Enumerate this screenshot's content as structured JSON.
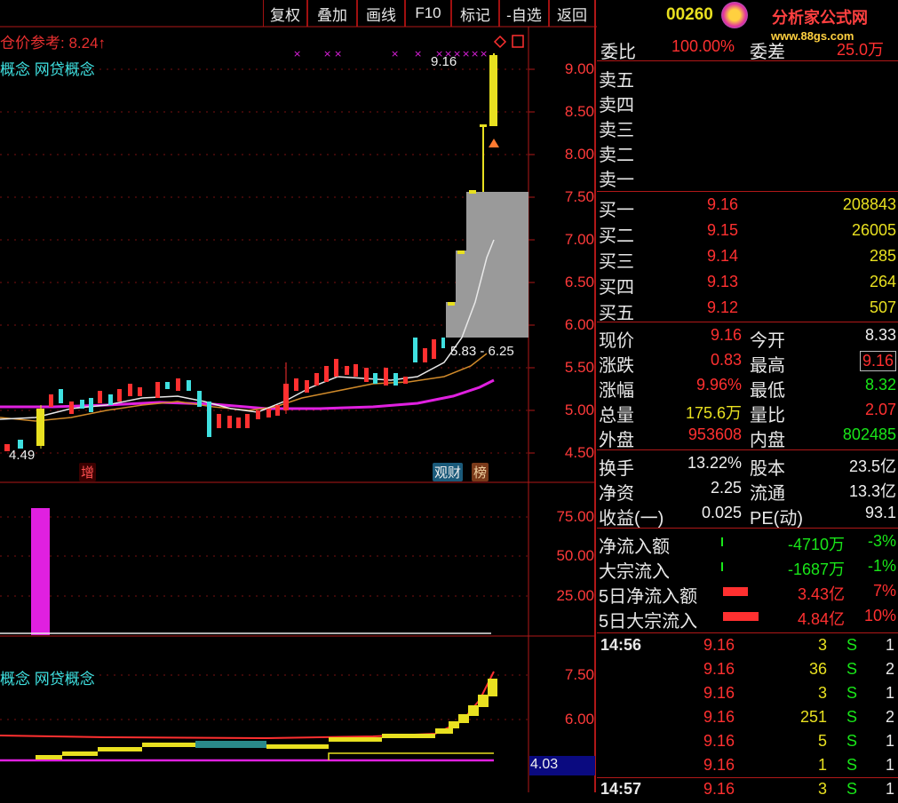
{
  "toolbar": {
    "buttons": [
      "复权",
      "叠加",
      "画线",
      "F10",
      "标记",
      "-自选",
      "返回"
    ]
  },
  "stock": {
    "code": "00260",
    "watermark_brand": "分析家公式网",
    "watermark_url": "www.88gs.com"
  },
  "main_chart": {
    "ref_price_label": "仓价参考: 8.24",
    "concept_label": "概念 网贷概念",
    "high_marker": "9.16",
    "range_marker": "5.83 - 6.25",
    "low_marker": "4.49",
    "tag_zeng": "增",
    "tag_guan": "观财",
    "tag_bang": "榜",
    "y_axis": [
      "9.00",
      "8.50",
      "8.00",
      "7.50",
      "7.00",
      "6.50",
      "6.00",
      "5.50",
      "5.00",
      "4.50"
    ]
  },
  "vol_chart": {
    "y_axis": [
      "75.00",
      "50.00",
      "25.00"
    ]
  },
  "ind_chart": {
    "concept_label": "概念 网贷概念",
    "y_axis": [
      "7.50",
      "6.00"
    ],
    "current_value": "4.03"
  },
  "order_book": {
    "weibi_label": "委比",
    "weibi_value": "100.00%",
    "weicha_label": "委差",
    "weicha_value": "25.0万",
    "sells": [
      "卖五",
      "卖四",
      "卖三",
      "卖二",
      "卖一"
    ],
    "buys": [
      {
        "label": "买一",
        "price": "9.16",
        "vol": "208843"
      },
      {
        "label": "买二",
        "price": "9.15",
        "vol": "26005"
      },
      {
        "label": "买三",
        "price": "9.14",
        "vol": "285"
      },
      {
        "label": "买四",
        "price": "9.13",
        "vol": "264"
      },
      {
        "label": "买五",
        "price": "9.12",
        "vol": "507"
      }
    ]
  },
  "quote": {
    "rows": [
      {
        "l1": "现价",
        "v1": "9.16",
        "l2": "今开",
        "v2": "8.33"
      },
      {
        "l1": "涨跌",
        "v1": "0.83",
        "l2": "最高",
        "v2": "9.16"
      },
      {
        "l1": "涨幅",
        "v1": "9.96%",
        "l2": "最低",
        "v2": "8.32"
      },
      {
        "l1": "总量",
        "v1": "175.6万",
        "l2": "量比",
        "v2": "2.07"
      },
      {
        "l1": "外盘",
        "v1": "953608",
        "l2": "内盘",
        "v2": "802485"
      }
    ]
  },
  "fundamentals": {
    "rows": [
      {
        "l1": "换手",
        "v1": "13.22%",
        "l2": "股本",
        "v2": "23.5亿"
      },
      {
        "l1": "净资",
        "v1": "2.25",
        "l2": "流通",
        "v2": "13.3亿"
      },
      {
        "l1": "收益(一)",
        "v1": "0.025",
        "l2": "PE(动)",
        "v2": "93.1"
      }
    ]
  },
  "flows": {
    "rows": [
      {
        "label": "净流入额",
        "value": "-4710万",
        "pct": "-3%"
      },
      {
        "label": "大宗流入",
        "value": "-1687万",
        "pct": "-1%"
      },
      {
        "label": "5日净流入额",
        "value": "3.43亿",
        "pct": "7%"
      },
      {
        "label": "5日大宗流入",
        "value": "4.84亿",
        "pct": "10%"
      }
    ]
  },
  "ticks": {
    "time1": "14:56",
    "time2": "14:57",
    "rows": [
      {
        "price": "9.16",
        "vol": "3",
        "side": "S",
        "n": "1"
      },
      {
        "price": "9.16",
        "vol": "36",
        "side": "S",
        "n": "2"
      },
      {
        "price": "9.16",
        "vol": "3",
        "side": "S",
        "n": "1"
      },
      {
        "price": "9.16",
        "vol": "251",
        "side": "S",
        "n": "2"
      },
      {
        "price": "9.16",
        "vol": "5",
        "side": "S",
        "n": "1"
      },
      {
        "price": "9.16",
        "vol": "1",
        "side": "S",
        "n": "1"
      },
      {
        "price": "9.16",
        "vol": "3",
        "side": "S",
        "n": "1"
      }
    ]
  },
  "colors": {
    "up": "#ff3030",
    "down": "#3fe0e0",
    "grid": "#b01818",
    "ma_magenta": "#e020e0"
  }
}
